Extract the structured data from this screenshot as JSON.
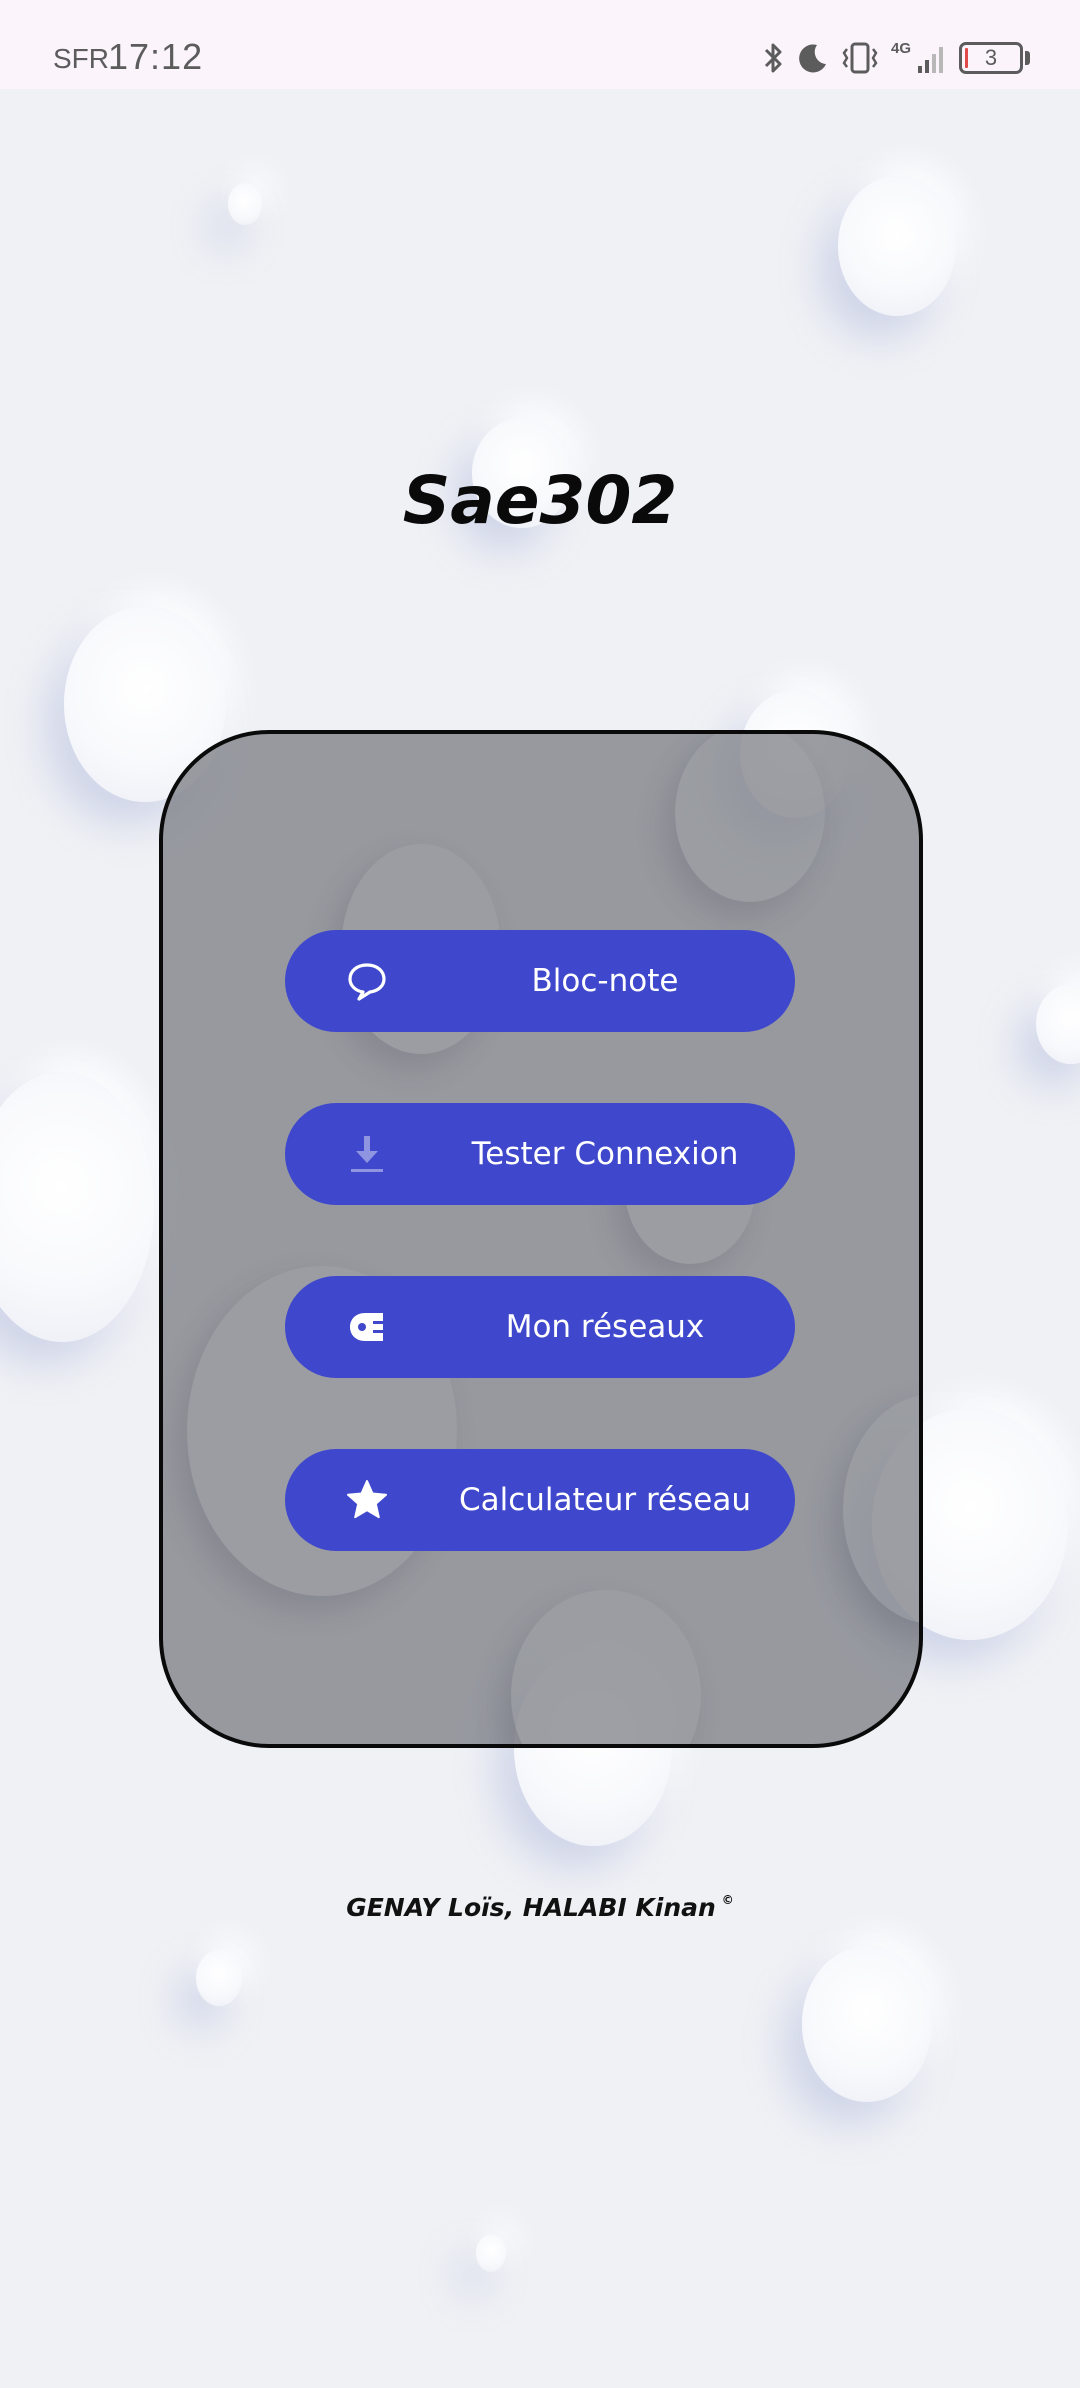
{
  "status_bar": {
    "carrier": "SFR",
    "time": "17:12",
    "network_type": "4G",
    "battery_level": "3",
    "icons": [
      "bluetooth-icon",
      "moon-icon",
      "vibrate-icon",
      "network-4g-icon",
      "signal-icon",
      "battery-icon"
    ]
  },
  "app": {
    "title": "Sae302"
  },
  "menu": {
    "buttons": [
      {
        "label": "Bloc-note",
        "icon": "chat-bubble-icon"
      },
      {
        "label": "Tester Connexion",
        "icon": "download-icon"
      },
      {
        "label": "Mon réseaux",
        "icon": "plug-icon"
      },
      {
        "label": "Calculateur réseau",
        "icon": "star-icon"
      }
    ]
  },
  "footer": {
    "credits": "GENAY Loïs, HALABI Kinan",
    "copyright_mark": "©"
  },
  "colors": {
    "background": "#eff1f5",
    "status_bar": "#fbf4fb",
    "card": "#7e8086",
    "button": "#3f48cc",
    "button_text": "#ffffff",
    "title": "#0a0a0a"
  }
}
